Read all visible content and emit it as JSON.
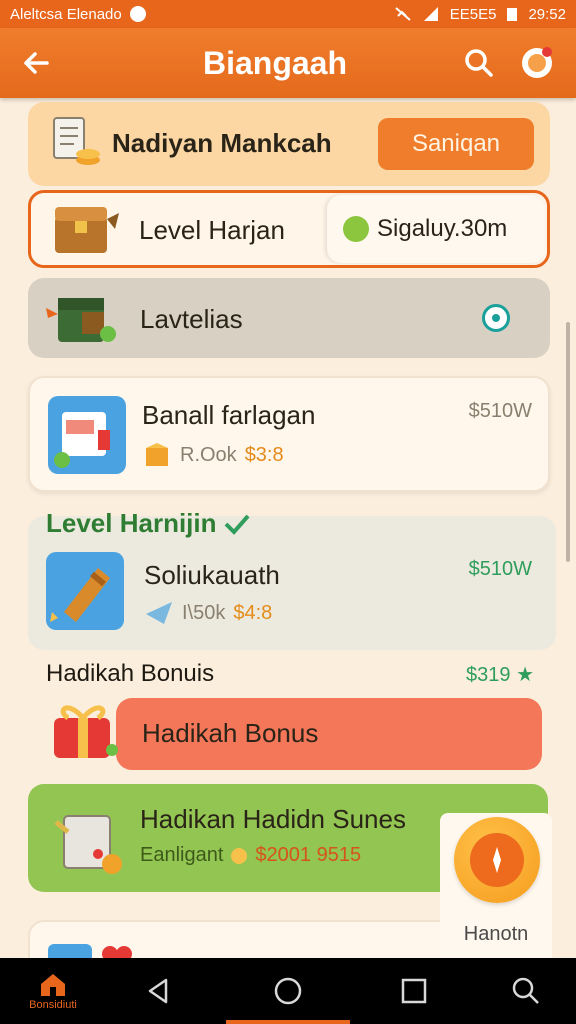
{
  "status_bar": {
    "carrier": "Aleltcsa Elenado",
    "right_label": "EE5E5",
    "time": "29:52"
  },
  "app_bar": {
    "title": "Biangaah"
  },
  "cards": {
    "c1": {
      "title": "Nadiyan Mankcah",
      "button": "Saniqan"
    },
    "c2": {
      "title": "Level Harjan",
      "timer": "Sigaluy.30m"
    },
    "c3": {
      "title": "Lavtelias"
    },
    "c4": {
      "title": "Banall farlagan",
      "qty": "R.Ook",
      "price_small": "$3:8",
      "price": "$510W"
    },
    "level_label": "Level Harnijin",
    "c5": {
      "title": "Soliukauath",
      "qty": "I\\50k",
      "price_small": "$4:8",
      "price": "$510W"
    },
    "bonus_section": {
      "label": "Hadikah Bonuis",
      "price": "$319"
    },
    "c6": {
      "title": "Hadikah Bonus"
    },
    "c7": {
      "title": "Hadikan Hadidn Sunes",
      "sub": "Eanligant",
      "price": "$2001 9515"
    }
  },
  "fab": {
    "label": "Hanotn"
  },
  "nav": {
    "home_label": "Bonsidiuti"
  },
  "colors": {
    "primary": "#e8661c",
    "green": "#2f9d5c",
    "card_green": "#92c552",
    "salmon": "#f4775a"
  }
}
